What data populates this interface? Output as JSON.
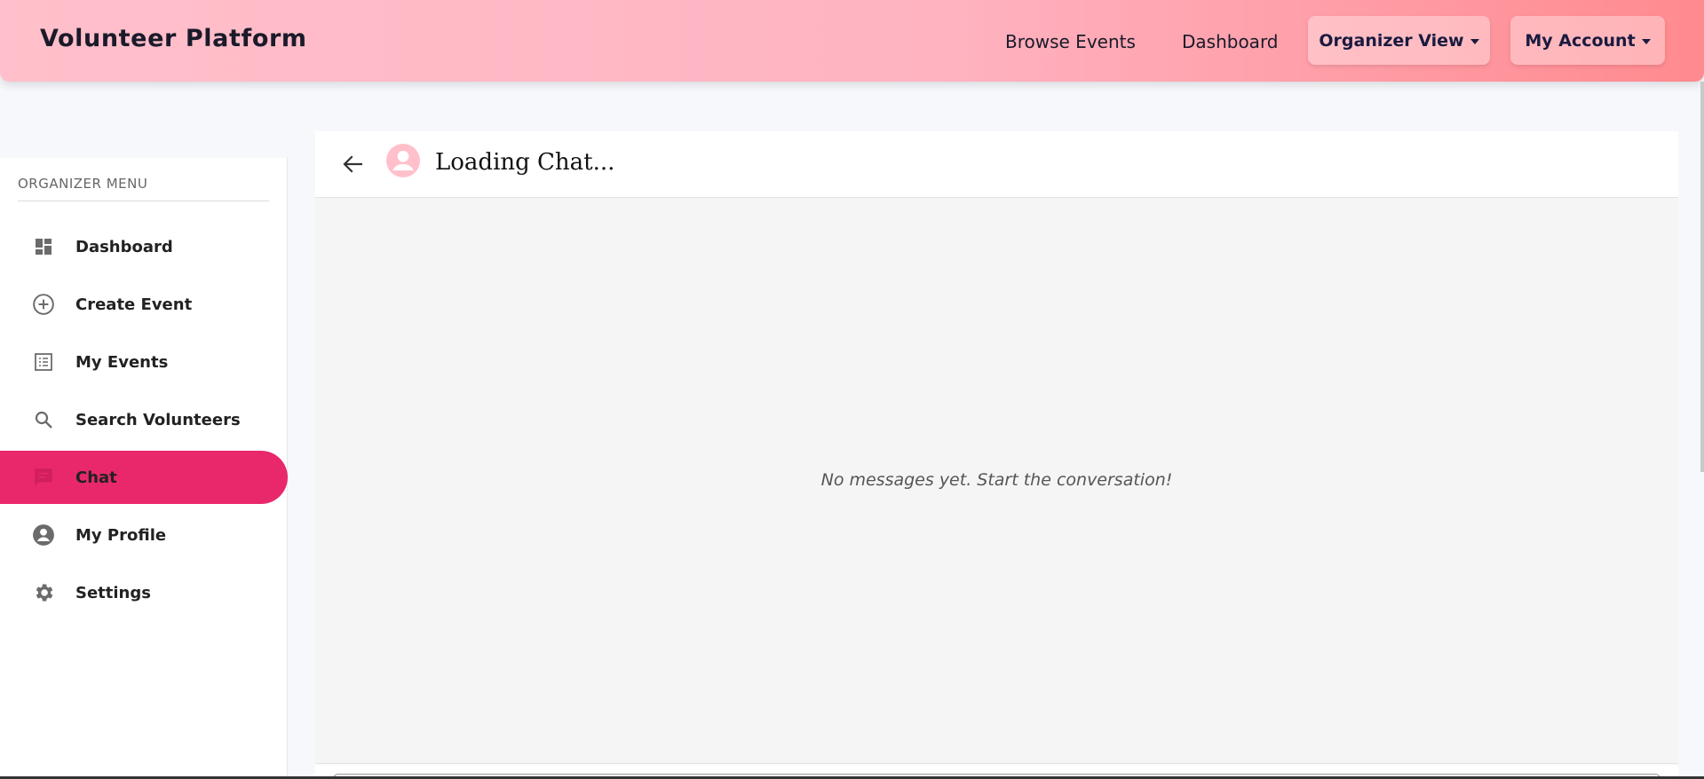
{
  "navbar": {
    "brand": "Volunteer Platform",
    "links": [
      "Browse Events",
      "Dashboard"
    ],
    "organizer_view": "Organizer View",
    "my_account": "My Account",
    "gradient_start": "#ffc0cb",
    "gradient_end": "#ff8a8f"
  },
  "sidebar": {
    "title": "ORGANIZER MENU",
    "items": [
      {
        "label": "Dashboard",
        "icon": "dashboard-icon"
      },
      {
        "label": "Create Event",
        "icon": "add-circle-icon"
      },
      {
        "label": "My Events",
        "icon": "list-icon"
      },
      {
        "label": "Search Volunteers",
        "icon": "search-icon"
      },
      {
        "label": "Chat",
        "icon": "chat-icon",
        "active": true
      },
      {
        "label": "My Profile",
        "icon": "account-circle-icon"
      },
      {
        "label": "Settings",
        "icon": "gear-icon"
      }
    ],
    "active_color": "#e9286b"
  },
  "chat": {
    "title": "Loading Chat...",
    "empty_message": "No messages yet. Start the conversation!"
  }
}
